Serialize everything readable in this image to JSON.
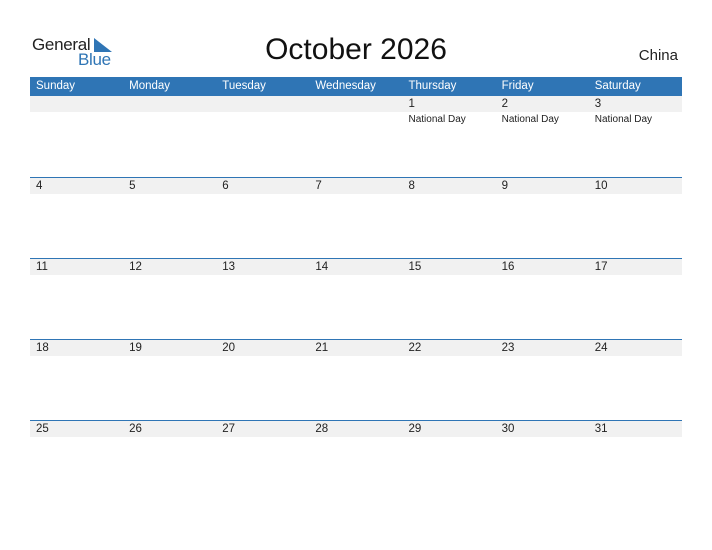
{
  "logo": {
    "word1": "General",
    "word2": "Blue",
    "brand_color": "#2f75b5"
  },
  "title": "October 2026",
  "country": "China",
  "weekdays": [
    "Sunday",
    "Monday",
    "Tuesday",
    "Wednesday",
    "Thursday",
    "Friday",
    "Saturday"
  ],
  "weeks": [
    [
      {
        "day": ""
      },
      {
        "day": ""
      },
      {
        "day": ""
      },
      {
        "day": ""
      },
      {
        "day": "1",
        "holiday": "National Day"
      },
      {
        "day": "2",
        "holiday": "National Day"
      },
      {
        "day": "3",
        "holiday": "National Day"
      }
    ],
    [
      {
        "day": "4"
      },
      {
        "day": "5"
      },
      {
        "day": "6"
      },
      {
        "day": "7"
      },
      {
        "day": "8"
      },
      {
        "day": "9"
      },
      {
        "day": "10"
      }
    ],
    [
      {
        "day": "11"
      },
      {
        "day": "12"
      },
      {
        "day": "13"
      },
      {
        "day": "14"
      },
      {
        "day": "15"
      },
      {
        "day": "16"
      },
      {
        "day": "17"
      }
    ],
    [
      {
        "day": "18"
      },
      {
        "day": "19"
      },
      {
        "day": "20"
      },
      {
        "day": "21"
      },
      {
        "day": "22"
      },
      {
        "day": "23"
      },
      {
        "day": "24"
      }
    ],
    [
      {
        "day": "25"
      },
      {
        "day": "26"
      },
      {
        "day": "27"
      },
      {
        "day": "28"
      },
      {
        "day": "29"
      },
      {
        "day": "30"
      },
      {
        "day": "31"
      }
    ]
  ]
}
